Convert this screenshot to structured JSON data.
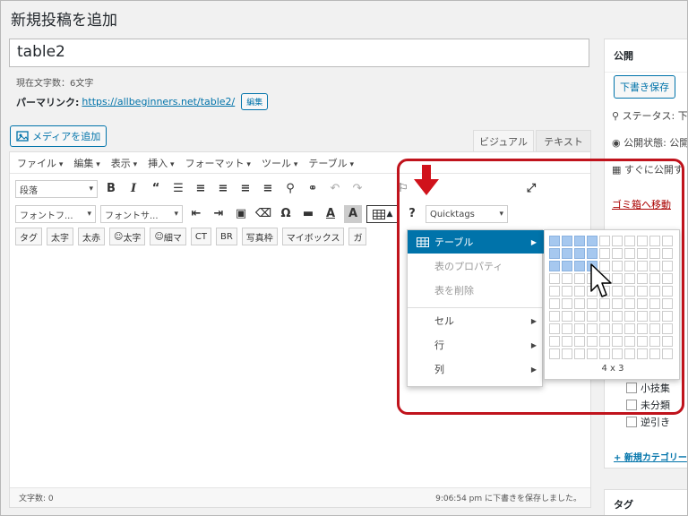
{
  "page": {
    "title": "新規投稿を追加"
  },
  "post": {
    "title": "table2",
    "char_count": "現在文字数：6文字",
    "permalink_label": "パーマリンク:",
    "permalink_url": "https://allbeginners.net/table2/",
    "edit_label": "編集"
  },
  "media_button": "メディアを追加",
  "tabs": {
    "visual": "ビジュアル",
    "text": "テキスト"
  },
  "menubar": [
    "ファイル",
    "編集",
    "表示",
    "挿入",
    "フォーマット",
    "ツール",
    "テーブル"
  ],
  "toolbar": {
    "format_select": "段落",
    "font_family": "フォントフ...",
    "font_size": "フォントサ...",
    "quicktags": "Quicktags",
    "buttons": [
      "タグ",
      "太字",
      "太赤",
      "太字",
      "細マ",
      "CT",
      "BR",
      "写真枠",
      "マイボックス",
      "ガ"
    ]
  },
  "editor_status": {
    "word_count": "文字数: 0",
    "saved": "9:06:54 pm に下書きを保存しました。"
  },
  "table_menu": {
    "items": [
      {
        "label": "テーブル",
        "state": "active"
      },
      {
        "label": "表のプロパティ",
        "state": "disabled"
      },
      {
        "label": "表を削除",
        "state": "disabled"
      },
      {
        "label": "セル",
        "state": "normal"
      },
      {
        "label": "行",
        "state": "normal"
      },
      {
        "label": "列",
        "state": "normal"
      }
    ],
    "grid_label": "4 x 3",
    "grid_selected": {
      "cols": 4,
      "rows": 3
    },
    "grid_size": {
      "cols": 10,
      "rows": 10
    }
  },
  "sidebar": {
    "publish_title": "公開",
    "save_draft": "下書き保存",
    "status_label": "ステータス: 下",
    "visibility_label": "公開状態: 公開",
    "publish_immediately": "すぐに公開す",
    "trash": "ゴミ箱へ移動",
    "categories": [
      "小技集",
      "未分類",
      "逆引き"
    ],
    "add_category": "+ 新規カテゴリー",
    "tags_title": "タグ"
  },
  "colors": {
    "accent": "#0073aa",
    "highlight": "#c0131c",
    "grid_selected": "#a6c8ef"
  }
}
